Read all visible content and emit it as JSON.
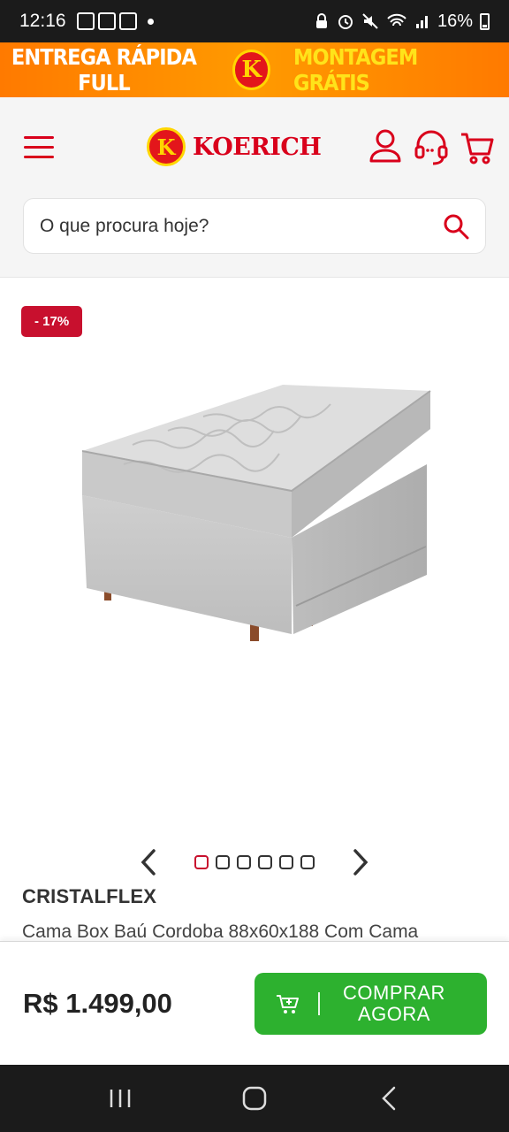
{
  "status_bar": {
    "time": "12:16",
    "battery": "16%"
  },
  "promo": {
    "left_text": "ENTREGA RÁPIDA FULL",
    "logo_letter": "K",
    "right_text": "MONTAGEM GRÁTIS"
  },
  "header": {
    "brand_letter": "K",
    "brand_name": "KOERICH"
  },
  "search": {
    "placeholder": "O que procura hoje?"
  },
  "product": {
    "discount_badge": "- 17%",
    "brand": "CRISTALFLEX",
    "title": "Cama Box Baú Cordoba 88x60x188 Com Cama",
    "images_count": 6,
    "active_image": 1
  },
  "buy_bar": {
    "price": "R$ 1.499,00",
    "button_line1": "COMPRAR",
    "button_line2": "AGORA"
  },
  "colors": {
    "brand_red": "#d9001b",
    "promo_orange": "#ff8a00",
    "buy_green": "#2db12f"
  }
}
